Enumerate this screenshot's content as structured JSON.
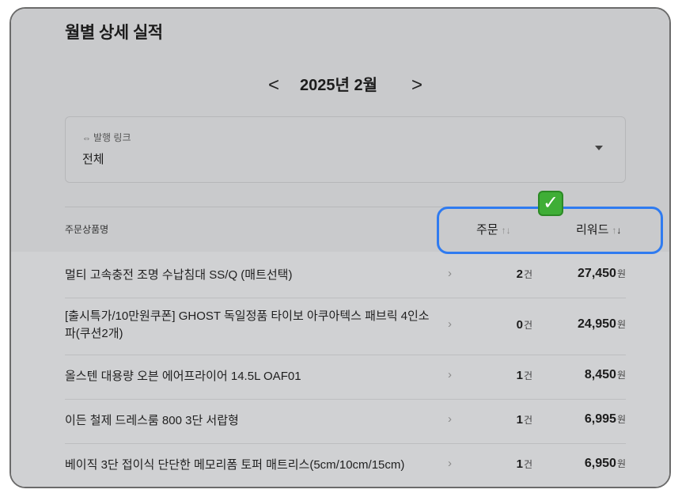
{
  "page": {
    "title": "월별 상세 실적"
  },
  "month_nav": {
    "prev": "<",
    "label": "2025년 2월",
    "next": ">"
  },
  "filter": {
    "label": "발행 링크",
    "value": "전체",
    "icon": "link-icon"
  },
  "table": {
    "headers": {
      "name": "주문상품명",
      "orders": "주문",
      "reward": "리워드"
    },
    "sort": {
      "orders": "none",
      "reward": "descending"
    },
    "rows": [
      {
        "name": "멀티 고속충전 조명 수납침대 SS/Q (매트선택)",
        "orders": "2",
        "orders_unit": "건",
        "reward": "27,450",
        "reward_unit": "원"
      },
      {
        "name": "[출시특가/10만원쿠폰] GHOST 독일정품 타이보 아쿠아텍스 패브릭 4인소파(쿠션2개)",
        "orders": "0",
        "orders_unit": "건",
        "reward": "24,950",
        "reward_unit": "원"
      },
      {
        "name": "올스텐 대용량 오븐 에어프라이어 14.5L OAF01",
        "orders": "1",
        "orders_unit": "건",
        "reward": "8,450",
        "reward_unit": "원"
      },
      {
        "name": "이든 철제 드레스룸 800 3단 서랍형",
        "orders": "1",
        "orders_unit": "건",
        "reward": "6,995",
        "reward_unit": "원"
      },
      {
        "name": "베이직 3단 접이식 단단한 메모리폼 토퍼 매트리스(5cm/10cm/15cm)",
        "orders": "1",
        "orders_unit": "건",
        "reward": "6,950",
        "reward_unit": "원"
      }
    ]
  },
  "annotation": {
    "badge": "✓",
    "highlight_color": "#2f7bf0",
    "badge_color": "#3fae36"
  }
}
